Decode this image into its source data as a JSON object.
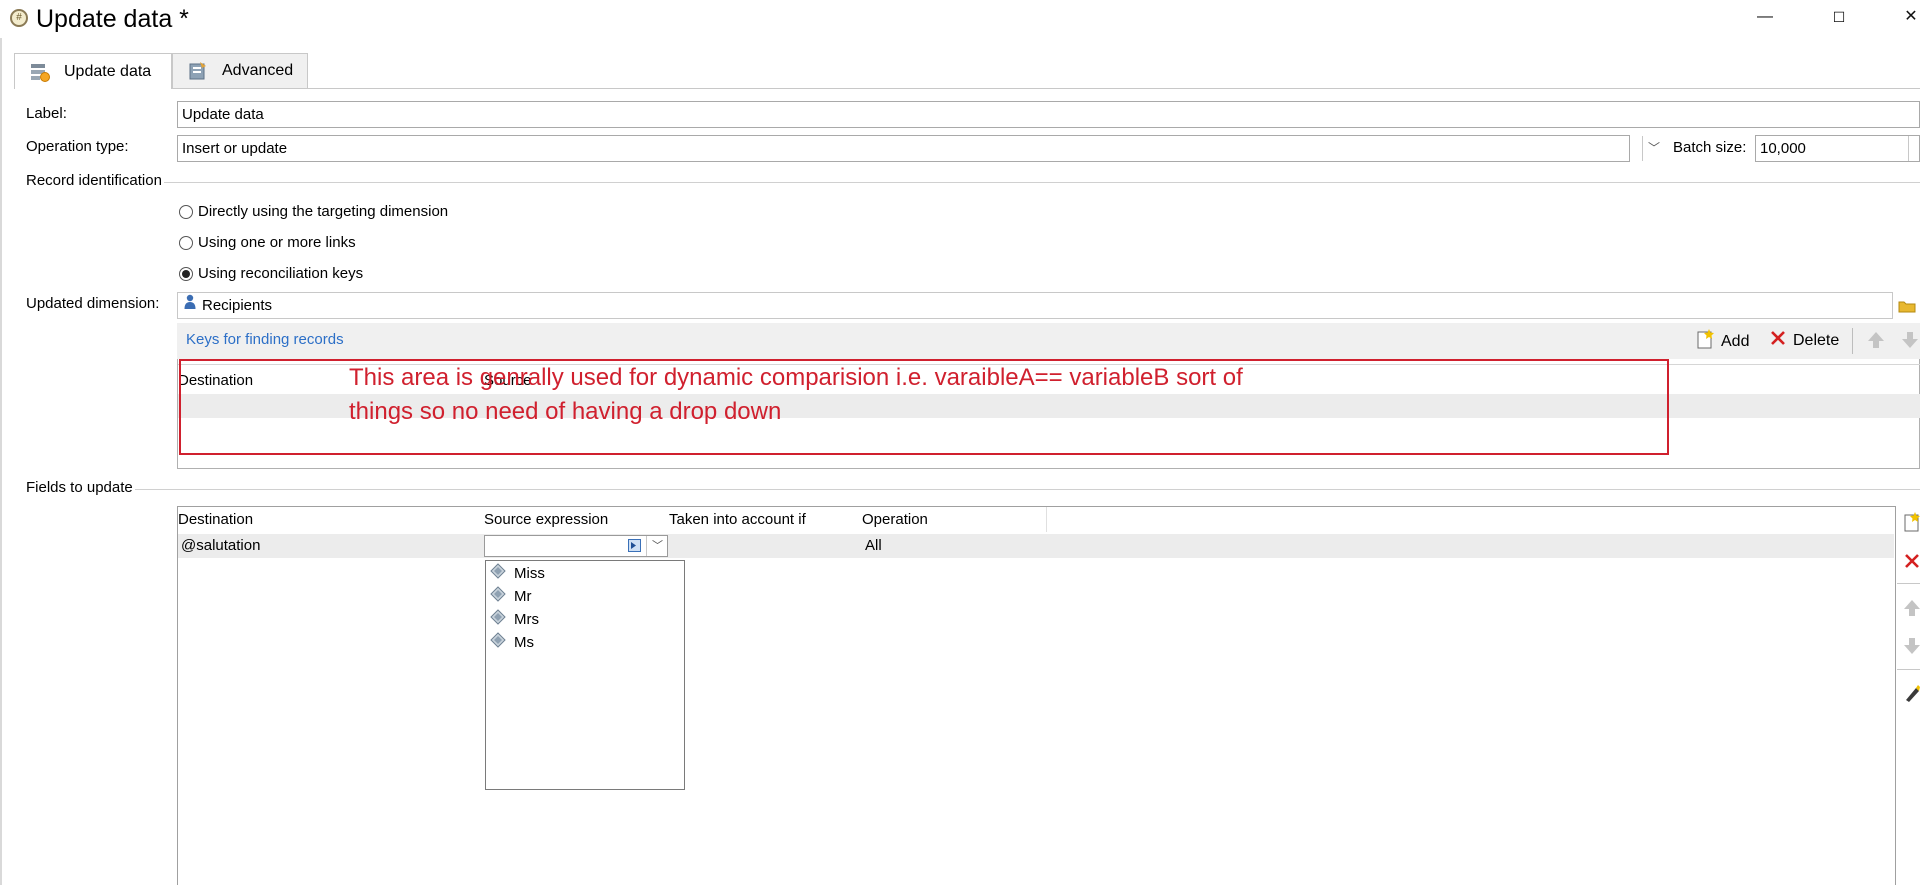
{
  "window": {
    "title": "Update data *",
    "minimize_glyph": "—",
    "maximize_glyph": "☐",
    "close_glyph": "✕"
  },
  "tabs": [
    {
      "label": "Update data",
      "icon": "update-data-icon",
      "selected": true
    },
    {
      "label": "Advanced",
      "icon": "advanced-icon",
      "selected": false
    }
  ],
  "form": {
    "label_caption": "Label:",
    "label_value": "Update data",
    "operation_caption": "Operation type:",
    "operation_value": "Insert or update",
    "batch_caption": "Batch size:",
    "batch_value": "10,000",
    "record_identification_caption": "Record identification",
    "radios": [
      {
        "label": "Directly using the targeting dimension",
        "checked": false
      },
      {
        "label": "Using one or more links",
        "checked": false
      },
      {
        "label": "Using reconciliation keys",
        "checked": true
      }
    ],
    "dimension_caption": "Updated dimension:",
    "dimension_value": "Recipients"
  },
  "keys": {
    "title": "Keys for finding records",
    "add_label": "Add",
    "delete_label": "Delete",
    "columns": [
      "Destination",
      "Source"
    ]
  },
  "annotation": {
    "line1": "This area is genrally used for dynamic comparision i.e. varaibleA== variableB sort of",
    "line2": "things so no need of having a drop down",
    "color": "#d0202e"
  },
  "fields": {
    "caption": "Fields to update",
    "columns": [
      "Destination",
      "Source expression",
      "Taken into account if",
      "Operation"
    ],
    "rows": [
      {
        "destination": "@salutation",
        "source": "",
        "condition": "",
        "operation": "All"
      }
    ],
    "dropdown_options": [
      "Miss",
      "Mr",
      "Mrs",
      "Ms"
    ]
  }
}
